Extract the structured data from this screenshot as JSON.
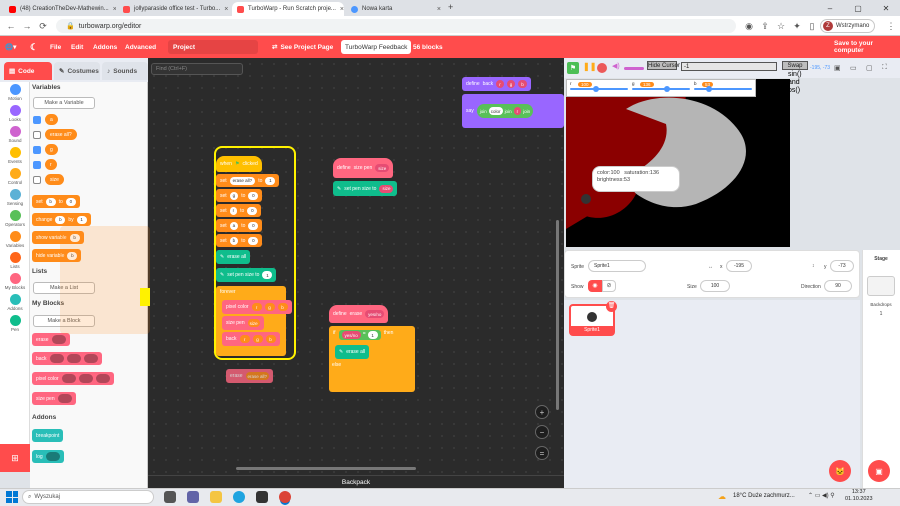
{
  "browser": {
    "tabs": [
      {
        "label": "(48) CreationTheDev-Mathewin...",
        "color": "#ff0000"
      },
      {
        "label": "jollyparaside office test - Turbo...",
        "color": "#ff4c4c"
      },
      {
        "label": "TurboWarp - Run Scratch proje...",
        "color": "#ff4c4c"
      },
      {
        "label": "Nowa karta",
        "color": "#4c97ff"
      }
    ],
    "url": "turbowarp.org/editor",
    "profile_letter": "Z",
    "profile_label": "Wstrzymano"
  },
  "menubar": {
    "file": "File",
    "edit": "Edit",
    "addons": "Addons",
    "advanced": "Advanced",
    "project_title": "Project",
    "see_project_page": "See Project Page",
    "feedback": "TurboWarp Feedback",
    "blocks_count": "56 blocks",
    "save": "Save to your computer"
  },
  "editor_tabs": {
    "code": "Code",
    "costumes": "Costumes",
    "sounds": "Sounds"
  },
  "categories": [
    {
      "label": "Motion",
      "color": "#4c97ff"
    },
    {
      "label": "Looks",
      "color": "#9966ff"
    },
    {
      "label": "Sound",
      "color": "#cf63cf"
    },
    {
      "label": "Events",
      "color": "#ffbf00"
    },
    {
      "label": "Control",
      "color": "#ffab19"
    },
    {
      "label": "Sensing",
      "color": "#5cb1d6"
    },
    {
      "label": "Operators",
      "color": "#59c059"
    },
    {
      "label": "Variables",
      "color": "#ff8c1a"
    },
    {
      "label": "Lists",
      "color": "#ff661a"
    },
    {
      "label": "My Blocks",
      "color": "#ff6680"
    },
    {
      "label": "Addons",
      "color": "#29beb8"
    },
    {
      "label": "Pen",
      "color": "#0fbd8c"
    }
  ],
  "palette": {
    "variables_heading": "Variables",
    "make_variable": "Make a Variable",
    "vars": [
      "a",
      "erase all?",
      "g",
      "r",
      "size"
    ],
    "set_block": {
      "label": "set",
      "var": "b",
      "to": "to",
      "val": "0"
    },
    "change_block": {
      "label": "change",
      "var": "b",
      "by": "by",
      "val": "1"
    },
    "show_var": {
      "label": "show variable",
      "var": "b"
    },
    "hide_var": {
      "label": "hide variable",
      "var": "b"
    },
    "lists_heading": "Lists",
    "make_list": "Make a List",
    "myblocks_heading": "My Blocks",
    "make_block": "Make a Block",
    "custom": [
      "erase",
      "back",
      "pixel color",
      "size pen"
    ],
    "addons_heading": "Addons",
    "addon_blocks": [
      "breakpoint",
      "log"
    ]
  },
  "code": {
    "find_placeholder": "Find (Ctrl+F)",
    "backpack": "Backpack",
    "main_script": {
      "hat": "when",
      "hat2": "clicked",
      "lines": [
        {
          "a": "set",
          "b": "erase all?",
          "c": "to",
          "d": "1"
        },
        {
          "a": "set",
          "b": "g",
          "c": "to",
          "d": "0"
        },
        {
          "a": "set",
          "b": "r",
          "c": "to",
          "d": "0"
        },
        {
          "a": "set",
          "b": "a",
          "c": "to",
          "d": "0"
        },
        {
          "a": "set",
          "b": "b",
          "c": "to",
          "d": "0"
        }
      ],
      "erase_all": "erase all",
      "set_pen_size": "set pen size to",
      "pen_size_val": "1",
      "forever": "forever",
      "pixel_color": "pixel color",
      "size_pen": "size pen",
      "size_arg": "size",
      "back": "back"
    },
    "define_size": {
      "define": "define",
      "name": "size pen",
      "arg": "size",
      "set_pen": "set pen size to",
      "arg2": "size"
    },
    "define_erase": {
      "define": "define",
      "name": "erase",
      "arg": "yes/no",
      "if": "if",
      "eq_left": "yes/no",
      "eq": "=",
      "eq_right": "1",
      "then": "then",
      "erase_all": "erase all",
      "else": "else"
    },
    "loose": {
      "erase": "erase",
      "arg": "erase all?"
    },
    "top_define": {
      "define": "define",
      "name": "back",
      "say": "say",
      "join": "join",
      "color": "color",
      "j2": "join",
      "r": "r",
      "j3": "join"
    }
  },
  "stage": {
    "hide_cursor": "Hide Cursor",
    "text_field_value": "-1",
    "swap_label": "Swap",
    "swap_rest": "sin()\nand\nos()",
    "coords": "-195, -73",
    "monitors": [
      {
        "name": "r",
        "value": "100"
      },
      {
        "name": "g",
        "value": "136"
      },
      {
        "name": "b",
        "value": "53"
      }
    ],
    "bubble": "color:100   saturation:136\nbrightness:53"
  },
  "sprite": {
    "sprite_label": "Sprite",
    "name": "Sprite1",
    "x_label": "x",
    "x": "-195",
    "y_label": "y",
    "y": "-73",
    "show_label": "Show",
    "size_label": "Size",
    "size": "100",
    "direction_label": "Direction",
    "direction": "90",
    "card_name": "Sprite1"
  },
  "stage_col": {
    "label": "Stage",
    "backdrops_label": "Backdrops",
    "backdrops_count": "1"
  },
  "taskbar": {
    "search": "Wyszukaj",
    "weather": "18°C  Duże zachmurz...",
    "time": "13:37",
    "date": "01.10.2023"
  }
}
